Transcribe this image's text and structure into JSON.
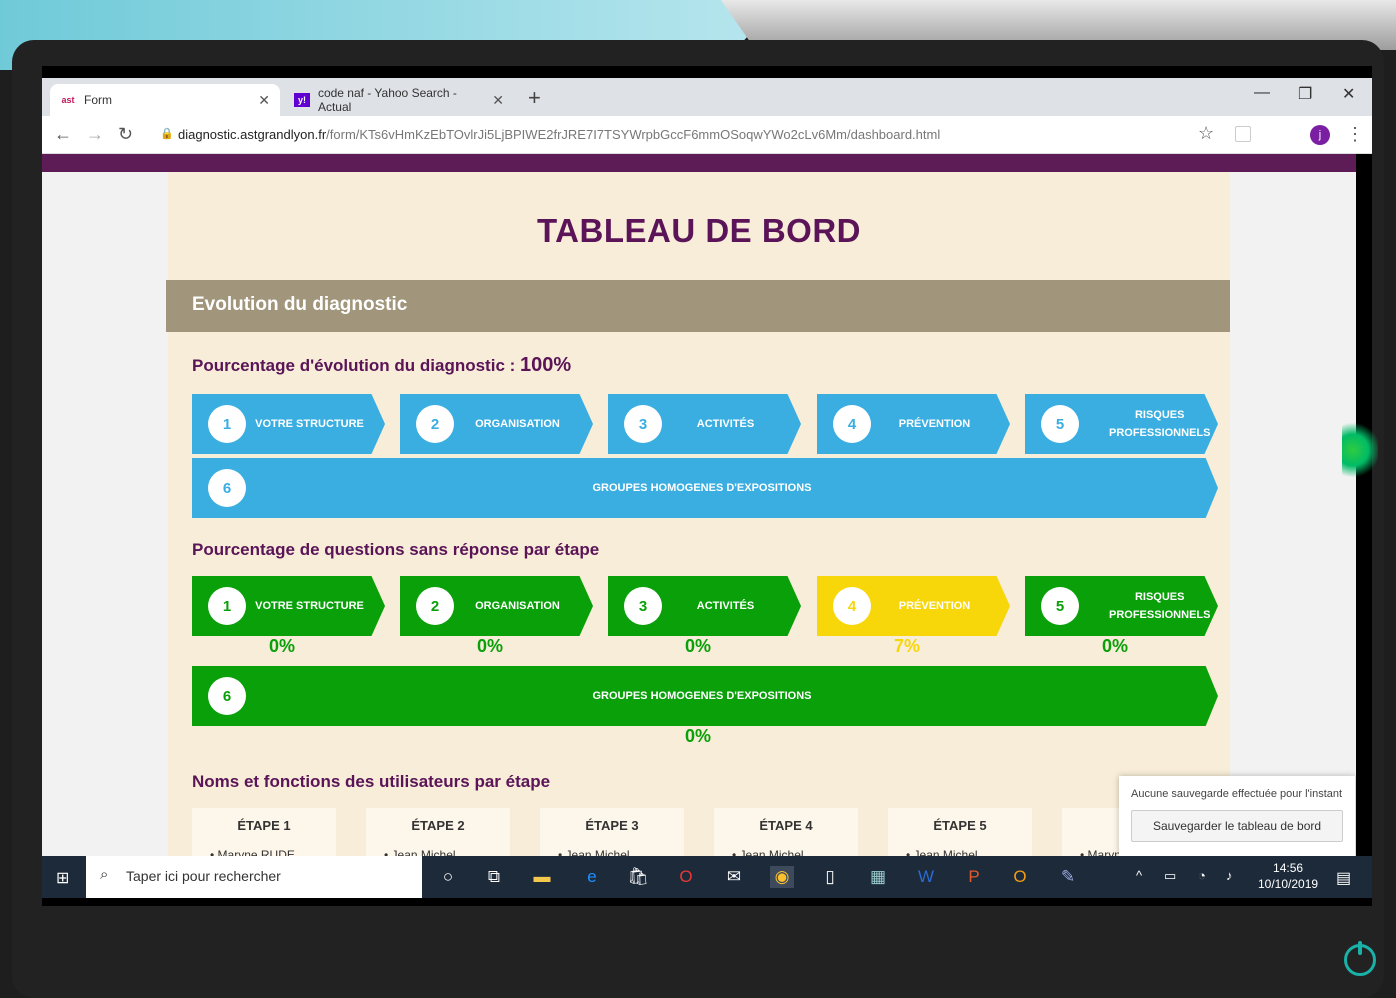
{
  "browser": {
    "tabs": [
      {
        "label": "Form",
        "favicon": "ast"
      },
      {
        "label": "code naf - Yahoo Search - Actual",
        "favicon": "y!"
      }
    ],
    "url_domain": "diagnostic.astgrandlyon.fr",
    "url_path": "/form/KTs6vHmKzEbTOvlrJi5LjBPIWE2frJRE7I7TSYWrpbGccF6mmOSoqwYWo2cLv6Mm/dashboard.html",
    "avatar_letter": "j"
  },
  "page": {
    "title": "TABLEAU DE BORD",
    "section_header": "Evolution du diagnostic",
    "evolution_label": "Pourcentage d'évolution du diagnostic :",
    "evolution_value": "100%",
    "steps": [
      {
        "num": "1",
        "label": "VOTRE STRUCTURE"
      },
      {
        "num": "2",
        "label": "ORGANISATION"
      },
      {
        "num": "3",
        "label": "ACTIVITÉS"
      },
      {
        "num": "4",
        "label": "PRÉVENTION"
      },
      {
        "num": "5",
        "label": "RISQUES PROFESSIONNELS"
      },
      {
        "num": "6",
        "label": "GROUPES HOMOGENES D'EXPOSITIONS"
      }
    ],
    "unanswered_label": "Pourcentage de questions sans réponse par étape",
    "unanswered": [
      "0%",
      "0%",
      "0%",
      "7%",
      "0%",
      "0%"
    ],
    "users_label": "Noms et fonctions des utilisateurs par étape",
    "etapes": [
      {
        "label": "ÉTAPE 1",
        "user": "• Maryne RUDE"
      },
      {
        "label": "ÉTAPE 2",
        "user": "• Jean Michel"
      },
      {
        "label": "ÉTAPE 3",
        "user": "• Jean Michel"
      },
      {
        "label": "ÉTAPE 4",
        "user": "• Jean Michel"
      },
      {
        "label": "ÉTAPE 5",
        "user": "• Jean Michel"
      },
      {
        "label": "ÉT",
        "user": "• Maryn"
      }
    ]
  },
  "save_popup": {
    "status": "Aucune sauvegarde effectuée pour l'instant",
    "button": "Sauvegarder le tableau de bord"
  },
  "taskbar": {
    "search_placeholder": "Taper ici pour rechercher",
    "time": "14:56",
    "date": "10/10/2019"
  },
  "colors": {
    "blue": "#3aaee0",
    "green": "#0aa00a",
    "yellow": "#f7d60a",
    "purple": "#5a1457"
  }
}
